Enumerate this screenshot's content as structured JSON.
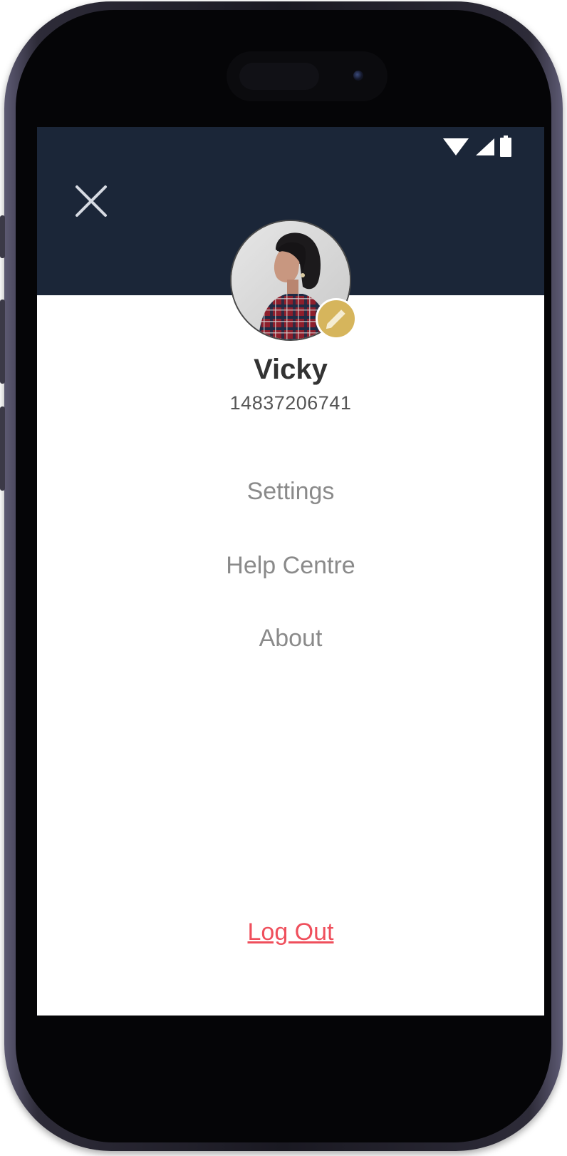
{
  "profile": {
    "name": "Vicky",
    "phone": "14837206741"
  },
  "menu": {
    "items": [
      {
        "label": "Settings"
      },
      {
        "label": "Help Centre"
      },
      {
        "label": "About"
      }
    ],
    "logout_label": "Log Out"
  },
  "icons": {
    "close": "close-icon",
    "edit": "pencil-icon",
    "wifi": "wifi-icon",
    "signal": "cellular-signal-icon",
    "battery": "battery-icon"
  },
  "colors": {
    "header_bg": "#1b2638",
    "edit_badge": "#d6b55c",
    "logout": "#ef4f5c",
    "menu_text": "#8a8a8a",
    "name_text": "#333333"
  }
}
